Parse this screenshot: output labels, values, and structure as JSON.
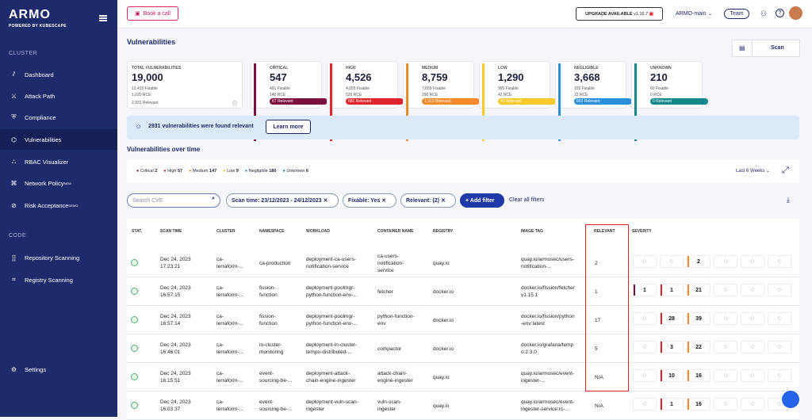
{
  "brand": {
    "name": "ARMO",
    "sub": "POWERED BY KUBESCAPE"
  },
  "sidebar": {
    "sections": [
      "CLUSTER",
      "CODE"
    ],
    "items": [
      {
        "label": "Dashboard",
        "icon": "chart-icon"
      },
      {
        "label": "Attack Path",
        "icon": "path-icon"
      },
      {
        "label": "Compliance",
        "icon": "shield-icon"
      },
      {
        "label": "Vulnerabilities",
        "icon": "bug-icon"
      },
      {
        "label": "RBAC Visualizer",
        "icon": "rbac-icon"
      },
      {
        "label": "Network Policy",
        "icon": "network-icon",
        "badge": "NEW"
      },
      {
        "label": "Risk Acceptance",
        "icon": "risk-icon",
        "badge": "DEMO"
      },
      {
        "label": "Repository Scanning",
        "icon": "repo-icon"
      },
      {
        "label": "Registry Scanning",
        "icon": "registry-icon"
      },
      {
        "label": "Settings",
        "icon": "gear-icon"
      }
    ]
  },
  "topbar": {
    "book": "Book a call",
    "upgrade": "UPGRADE AVAILABLE",
    "version": "v1.16.7",
    "org": "ARMO-main",
    "team": "Team"
  },
  "page": {
    "title": "Vulnerabilities",
    "scan": "Scan"
  },
  "cards": [
    {
      "label": "TOTAL VULNERABILITIES",
      "num": "19,000",
      "a": "13,415 Fixable",
      "b": "1,020 RCE",
      "c": "2,931 Relevant",
      "color": ""
    },
    {
      "label": "CRITICAL",
      "num": "547",
      "a": "491 Fixable",
      "b": "140 RCE",
      "c": "67 Relevant",
      "color": "#7b1040"
    },
    {
      "label": "HIGH",
      "num": "4,526",
      "a": "4,055 Fixable",
      "b": "526 RCE",
      "c": "681 Relevant",
      "color": "#e0242e"
    },
    {
      "label": "MEDIUM",
      "num": "8,759",
      "a": "7,659 Fixable",
      "b": "290 RCE",
      "c": "1,319 Relevant",
      "color": "#f5892b"
    },
    {
      "label": "LOW",
      "num": "1,290",
      "a": "995 Fixable",
      "b": "42 RCE",
      "c": "42 Relevant",
      "color": "#f7c92b"
    },
    {
      "label": "NEGLIGIBLE",
      "num": "3,668",
      "a": "155 Fixable",
      "b": "22 RCE",
      "c": "802 Relevant",
      "color": "#2b8fdb"
    },
    {
      "label": "UNKNOWN",
      "num": "210",
      "a": "60 Fixable",
      "b": "0 RCE",
      "c": "0 Relevant",
      "color": "#14878a"
    }
  ],
  "banner": {
    "text": "2931 vulnerabilities were found relevant",
    "btn": "Learn more"
  },
  "overtime": {
    "title": "Vulnerabilities over time",
    "range": "Last 6 Weeks",
    "legend": [
      {
        "name": "Critical",
        "v": "2",
        "c": "#7b1040"
      },
      {
        "name": "High",
        "v": "57",
        "c": "#e0242e"
      },
      {
        "name": "Medium",
        "v": "147",
        "c": "#f5892b"
      },
      {
        "name": "Low",
        "v": "9",
        "c": "#f7c92b"
      },
      {
        "name": "Negligible",
        "v": "180",
        "c": "#2b8fdb"
      },
      {
        "name": "Unknown",
        "v": "6",
        "c": "#14878a"
      }
    ]
  },
  "filters": {
    "search_placeholder": "Search CVE",
    "chips": [
      "Scan time: 23/12/2023 - 24/12/2023",
      "Fixable: Yes",
      "Relevant: (2)"
    ],
    "add": "+ Add filter",
    "clear": "Clear all filters"
  },
  "table": {
    "headers": [
      "STAT.",
      "SCAN TIME",
      "CLUSTER",
      "NAMESPACE",
      "WORKLOAD",
      "CONTAINER NAME",
      "REGISTRY",
      "IMAGE TAG",
      "RELEVANT",
      "SEVERITY"
    ],
    "rows": [
      {
        "time": [
          "Dec 24, 2023",
          "17:23:21"
        ],
        "cluster": [
          "ca-",
          "terraform-..."
        ],
        "ns": [
          "ca-production"
        ],
        "wl": [
          "deployment-ca-users-",
          "notification-service"
        ],
        "cn": [
          "ca-users-",
          "notification-",
          "service"
        ],
        "reg": "quay.io",
        "tag": [
          "quay.io/armosec/users-",
          "notification-..."
        ],
        "rel": "2",
        "sev": [
          "0",
          "0",
          "2",
          "0",
          "0",
          "0"
        ]
      },
      {
        "time": [
          "Dec 24, 2023",
          "16:57:15"
        ],
        "cluster": [
          "ca-",
          "terraform-..."
        ],
        "ns": [
          "fission-",
          "function"
        ],
        "wl": [
          "deployment-poolmgr-",
          "python-function-env-..."
        ],
        "cn": [
          "fetcher"
        ],
        "reg": "docker.io",
        "tag": [
          "docker.io/fission/fetcher",
          "v1.15.1"
        ],
        "rel": "1",
        "sev": [
          "1",
          "1",
          "21",
          "0",
          "0",
          "0"
        ]
      },
      {
        "time": [
          "Dec 24, 2023",
          "16:57:14"
        ],
        "cluster": [
          "ca-",
          "terraform-..."
        ],
        "ns": [
          "fission-",
          "function"
        ],
        "wl": [
          "deployment-poolmgr-",
          "python-function-env-..."
        ],
        "cn": [
          "python-function-",
          "env"
        ],
        "reg": "docker.io",
        "tag": [
          "docker.io/fission/python",
          "-env:latest"
        ],
        "rel": "17",
        "sev": [
          "0",
          "28",
          "39",
          "0",
          "0",
          "0"
        ]
      },
      {
        "time": [
          "Dec 24, 2023",
          "16:46:01"
        ],
        "cluster": [
          "ca-",
          "terraform-..."
        ],
        "ns": [
          "in-cluster-",
          "monitoring"
        ],
        "wl": [
          "deployment-in-cluster-",
          "tempo-distributed-..."
        ],
        "cn": [
          "compactor"
        ],
        "reg": "docker.io",
        "tag": [
          "docker.io/grafana/temp",
          "o:2.3.0"
        ],
        "rel": "5",
        "sev": [
          "0",
          "3",
          "22",
          "0",
          "0",
          "0"
        ]
      },
      {
        "time": [
          "Dec 24, 2023",
          "16:15:51"
        ],
        "cluster": [
          "ca-",
          "terraform-..."
        ],
        "ns": [
          "event-",
          "sourcing-be-..."
        ],
        "wl": [
          "deployment-attack-",
          "chain-engine-ingester"
        ],
        "cn": [
          "attack-chain-",
          "engine-ingester"
        ],
        "reg": "quay.io",
        "tag": [
          "quay.io/armosec/event-",
          "ingester-..."
        ],
        "rel": "N/A",
        "sev": [
          "0",
          "10",
          "16",
          "0",
          "0",
          "0"
        ]
      },
      {
        "time": [
          "Dec 24, 2023",
          "16:03:37"
        ],
        "cluster": [
          "ca-",
          "terraform-..."
        ],
        "ns": [
          "event-",
          "sourcing-be-..."
        ],
        "wl": [
          "deployment-vuln-scan-",
          "ingester"
        ],
        "cn": [
          "vuln-scan-",
          "ingester"
        ],
        "reg": "quay.io",
        "tag": [
          "quay.io/armosec/event-",
          "ingester-service:rc-..."
        ],
        "rel": "N/A",
        "sev": [
          "0",
          "1",
          "16",
          "0",
          "0",
          "0"
        ]
      }
    ]
  },
  "sev_colors": [
    "#7b1040",
    "#e0242e",
    "#f5892b",
    "#f7c92b",
    "#2b8fdb",
    "#14878a"
  ]
}
